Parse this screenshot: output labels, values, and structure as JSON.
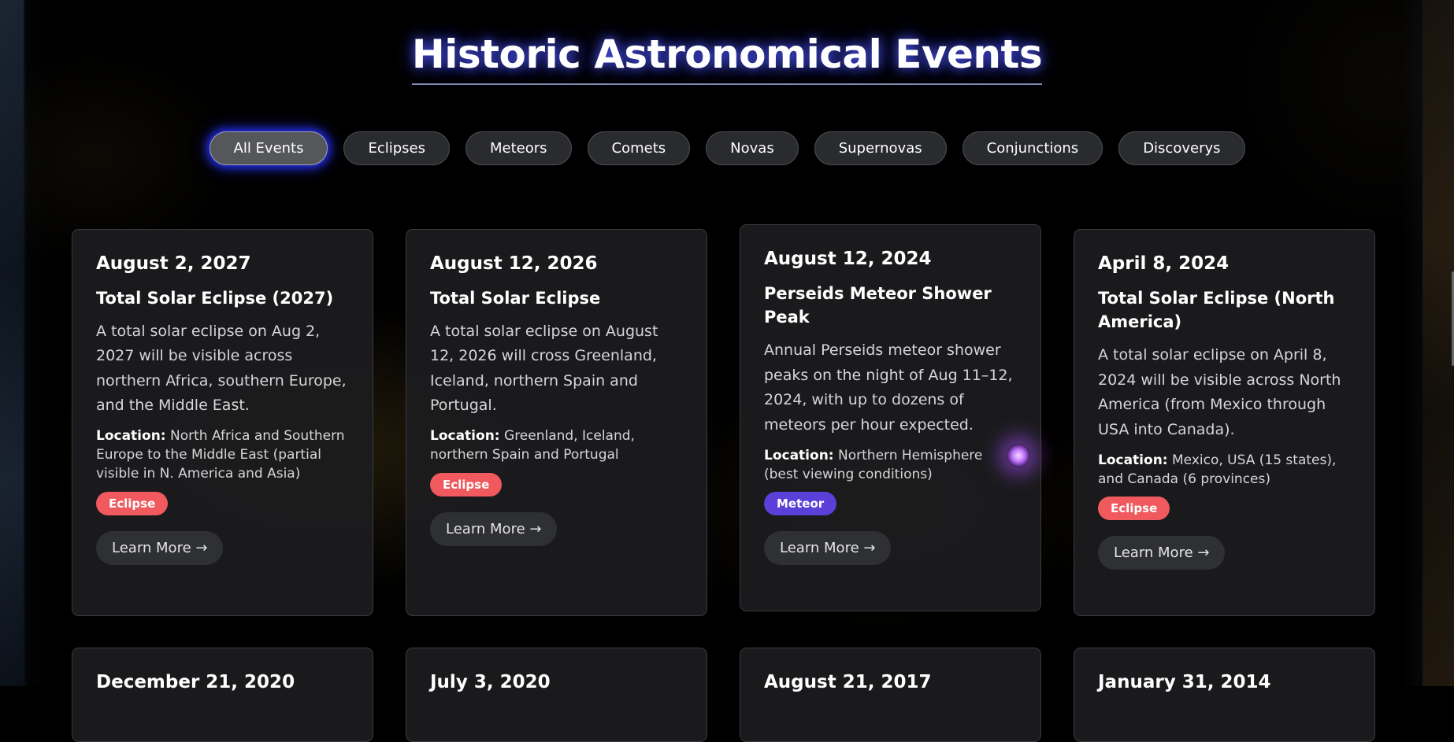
{
  "page": {
    "title": "Historic Astronomical Events"
  },
  "filters": [
    {
      "label": "All Events",
      "active": true
    },
    {
      "label": "Eclipses",
      "active": false
    },
    {
      "label": "Meteors",
      "active": false
    },
    {
      "label": "Comets",
      "active": false
    },
    {
      "label": "Novas",
      "active": false
    },
    {
      "label": "Supernovas",
      "active": false
    },
    {
      "label": "Conjunctions",
      "active": false
    },
    {
      "label": "Discoverys",
      "active": false
    }
  ],
  "location_label": "Location:",
  "events": [
    {
      "date": "August 2, 2027",
      "title": "Total Solar Eclipse (2027)",
      "description": "A total solar eclipse on Aug 2, 2027 will be visible across northern Africa, southern Europe, and the Middle East.",
      "location": "North Africa and Southern Europe to the Middle East (partial visible in N. America and Asia)",
      "tag": "Eclipse",
      "button": "Learn More →"
    },
    {
      "date": "August 12, 2026",
      "title": "Total Solar Eclipse",
      "description": "A total solar eclipse on August 12, 2026 will cross Greenland, Iceland, northern Spain and Portugal.",
      "location": "Greenland, Iceland, northern Spain and Portugal",
      "tag": "Eclipse",
      "button": "Learn More →"
    },
    {
      "date": "August 12, 2024",
      "title": "Perseids Meteor Shower Peak",
      "description": "Annual Perseids meteor shower peaks on the night of Aug 11–12, 2024, with up to dozens of meteors per hour expected.",
      "location": "Northern Hemisphere (best viewing conditions)",
      "tag": "Meteor",
      "button": "Learn More →"
    },
    {
      "date": "April 8, 2024",
      "title": "Total Solar Eclipse (North America)",
      "description": "A total solar eclipse on April 8, 2024 will be visible across North America (from Mexico through USA into Canada).",
      "location": "Mexico, USA (15 states), and Canada (6 provinces)",
      "tag": "Eclipse",
      "button": "Learn More →"
    },
    {
      "date": "December 21, 2020"
    },
    {
      "date": "July 3, 2020"
    },
    {
      "date": "August 21, 2017"
    },
    {
      "date": "January 31, 2014"
    }
  ],
  "colors": {
    "eclipse_tag": "#f05a5f",
    "meteor_tag": "#5a3fd8",
    "title_glow": "#3c46ff",
    "active_filter_glow": "#2832ff"
  }
}
